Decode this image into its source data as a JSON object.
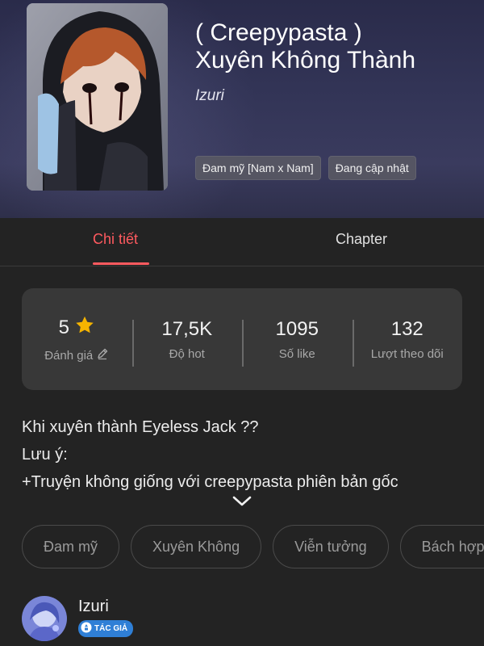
{
  "story": {
    "title_line1": "( Creepypasta )",
    "title_line2": "Xuyên Không Thành",
    "author": "Izuri",
    "top_tags": [
      "Đam mỹ [Nam x Nam]",
      "Đang cập nhật"
    ]
  },
  "tabs": {
    "detail": "Chi tiết",
    "chapter": "Chapter"
  },
  "stats": [
    {
      "value": "5",
      "label": "Đánh giá",
      "icon": "star-icon"
    },
    {
      "value": "17,5K",
      "label": "Độ hot"
    },
    {
      "value": "1095",
      "label": "Số like"
    },
    {
      "value": "132",
      "label": "Lượt theo dõi"
    }
  ],
  "description": [
    "Khi xuyên thành Eyeless Jack ??",
    "Lưu ý:",
    "+Truyện không giống với creepypasta phiên bản gốc"
  ],
  "genres": [
    "Đam mỹ",
    "Xuyên Không",
    "Viễn tưởng",
    "Bách hợp"
  ],
  "author_card": {
    "name": "Izuri",
    "badge": "TÁC GIẢ"
  },
  "colors": {
    "accent": "#ff5a5f",
    "star": "#f5b400",
    "badge": "#2f7fd6"
  }
}
